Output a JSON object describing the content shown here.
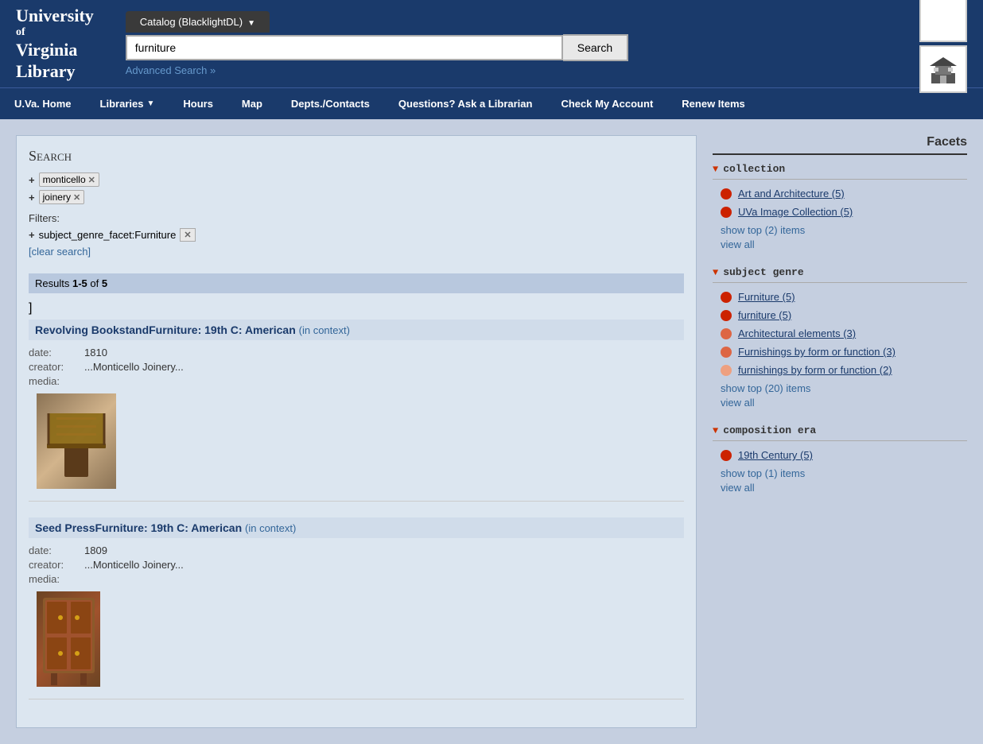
{
  "header": {
    "logo_line1": "University",
    "logo_line2": "of",
    "logo_line3": "Virginia",
    "logo_line4": "Library",
    "catalog_tab": "Catalog (BlacklightDL)",
    "search_input_value": "furniture",
    "search_button_label": "Search",
    "advanced_search_label": "Advanced Search »"
  },
  "nav": {
    "items": [
      {
        "label": "U.Va. Home",
        "has_arrow": false
      },
      {
        "label": "Libraries",
        "has_arrow": true
      },
      {
        "label": "Hours",
        "has_arrow": false
      },
      {
        "label": "Map",
        "has_arrow": false
      },
      {
        "label": "Depts./Contacts",
        "has_arrow": false
      },
      {
        "label": "Questions? Ask a Librarian",
        "has_arrow": false
      },
      {
        "label": "Check My Account",
        "has_arrow": false
      },
      {
        "label": "Renew Items",
        "has_arrow": false
      }
    ]
  },
  "search_panel": {
    "title": "Search",
    "tags": [
      {
        "value": "monticello"
      },
      {
        "value": "joinery"
      }
    ],
    "filters_label": "Filters:",
    "filter_tag": "subject_genre_facet:Furniture",
    "clear_search_label": "[clear search]",
    "results_label": "Results",
    "results_range": "1-5",
    "results_of": "of",
    "results_count": "5",
    "bracket": "]"
  },
  "results": [
    {
      "title": "Revolving BookstandFurniture: 19th C: American",
      "in_context": "(in context)",
      "date_label": "date:",
      "date_value": "1810",
      "creator_label": "creator:",
      "creator_value": "...Monticello Joinery...",
      "media_label": "media:",
      "media_value": ""
    },
    {
      "title": "Seed PressFurniture: 19th C: American",
      "in_context": "(in context)",
      "date_label": "date:",
      "date_value": "1809",
      "creator_label": "creator:",
      "creator_value": "...Monticello Joinery...",
      "media_label": "media:",
      "media_value": ""
    }
  ],
  "facets": {
    "header": "Facets",
    "sections": [
      {
        "title": "collection",
        "items": [
          {
            "label": "Art and Architecture (5)",
            "dot_class": "dark"
          },
          {
            "label": "UVa Image Collection (5)",
            "dot_class": "dark"
          }
        ],
        "show_top": "show top (2) items",
        "view_all": "view all"
      },
      {
        "title": "subject genre",
        "items": [
          {
            "label": "Furniture (5)",
            "dot_class": "dark"
          },
          {
            "label": "furniture (5)",
            "dot_class": "dark"
          },
          {
            "label": "Architectural elements (3)",
            "dot_class": "light"
          },
          {
            "label": "Furnishings by form or function (3)",
            "dot_class": "light"
          },
          {
            "label": "furnishings by form or function (2)",
            "dot_class": "lighter"
          }
        ],
        "show_top": "show top (20) items",
        "view_all": "view all"
      },
      {
        "title": "composition era",
        "items": [
          {
            "label": "19th Century (5)",
            "dot_class": "dark"
          }
        ],
        "show_top": "show top (1) items",
        "view_all": "view all"
      }
    ]
  }
}
